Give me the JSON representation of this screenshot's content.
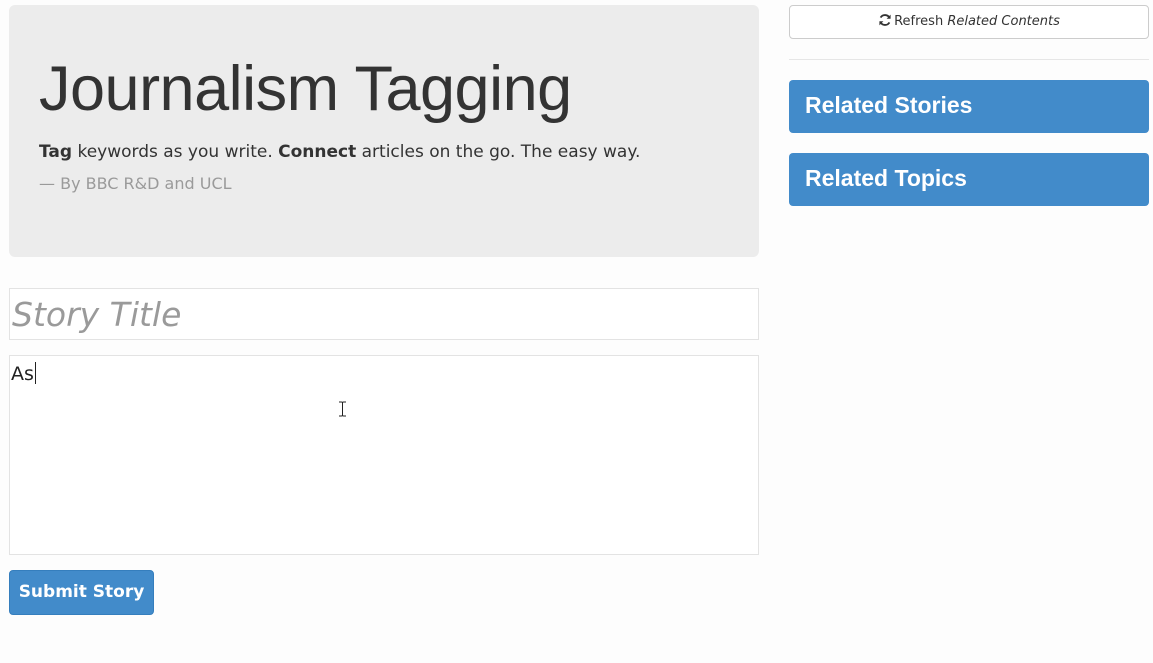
{
  "header": {
    "title": "Journalism Tagging",
    "lead": {
      "strong_1": "Tag",
      "text_1": " keywords as you write. ",
      "strong_2": "Connect",
      "text_2": " articles on the go. The easy way."
    },
    "byline": "— By BBC R&D and UCL"
  },
  "editor": {
    "title_placeholder": "Story Title",
    "title_value": "",
    "body_value": "As"
  },
  "actions": {
    "submit_label": "Submit Story"
  },
  "sidebar": {
    "refresh": {
      "label": "Refresh",
      "label_em": "Related Contents",
      "icon": "refresh-icon"
    },
    "panels": [
      {
        "label": "Related Stories"
      },
      {
        "label": "Related Topics"
      }
    ]
  },
  "colors": {
    "primary": "#428bca",
    "jumbotron_bg": "#ececec",
    "muted_text": "#9a9a9a"
  }
}
